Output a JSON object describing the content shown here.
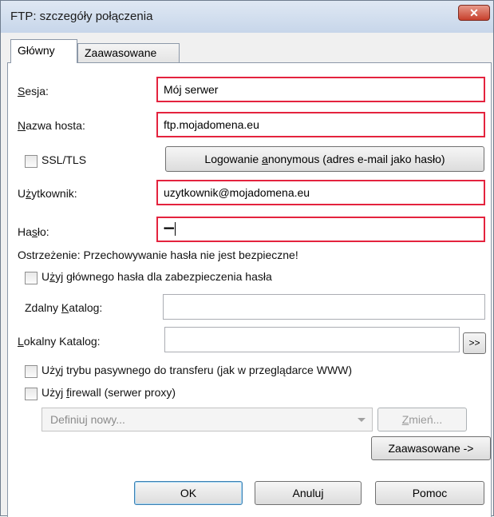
{
  "window": {
    "title": "FTP: szczegóły połączenia",
    "close_symbol": "✕"
  },
  "tabs": [
    {
      "label": "Główny",
      "active": true
    },
    {
      "label": "Zaawasowane",
      "active": false
    }
  ],
  "form": {
    "session": {
      "label_u": "S",
      "label_rest": "esja:",
      "value": "Mój serwer"
    },
    "host": {
      "label_u": "N",
      "label_rest": "azwa hosta:",
      "value": "ftp.mojadomena.eu"
    },
    "ssl": {
      "label": "SSL/TLS",
      "checked": false
    },
    "anon_button": {
      "pre": "Logowanie ",
      "u": "a",
      "post": "nonymous (adres e-mail jako hasło)"
    },
    "user": {
      "label_pre": "U",
      "label_u": "ż",
      "label_post": "ytkownik:",
      "value": "uzytkownik@mojadomena.eu"
    },
    "password": {
      "label_pre": "Ha",
      "label_u": "s",
      "label_post": "ło:",
      "value": "•••••"
    },
    "warning": "Ostrzeżenie: Przechowywanie hasła nie jest bezpieczne!",
    "master_pw": {
      "pre": "U",
      "u": "ż",
      "post": "yj głównego hasła dla zabezpieczenia hasła",
      "checked": false
    },
    "remote_dir": {
      "pre": "Zdalny ",
      "u": "K",
      "post": "atalog:",
      "value": ""
    },
    "local_dir": {
      "u": "L",
      "post": "okalny Katalog:",
      "value": "",
      "browse": ">>"
    },
    "passive": {
      "pre": "Uż",
      "u": "y",
      "post": "j trybu pasywnego do transferu (jak w przeglądarce WWW)",
      "checked": false
    },
    "firewall": {
      "pre": "Użyj ",
      "u": "f",
      "post": "irewall (serwer proxy)",
      "checked": false
    },
    "proxy_select": {
      "value": "Definiuj nowy..."
    },
    "change_button": {
      "u": "Z",
      "post": "mień..."
    },
    "advanced_button": "Zaawasowane ->"
  },
  "footer": {
    "ok": "OK",
    "cancel": "Anuluj",
    "help": "Pomoc"
  }
}
